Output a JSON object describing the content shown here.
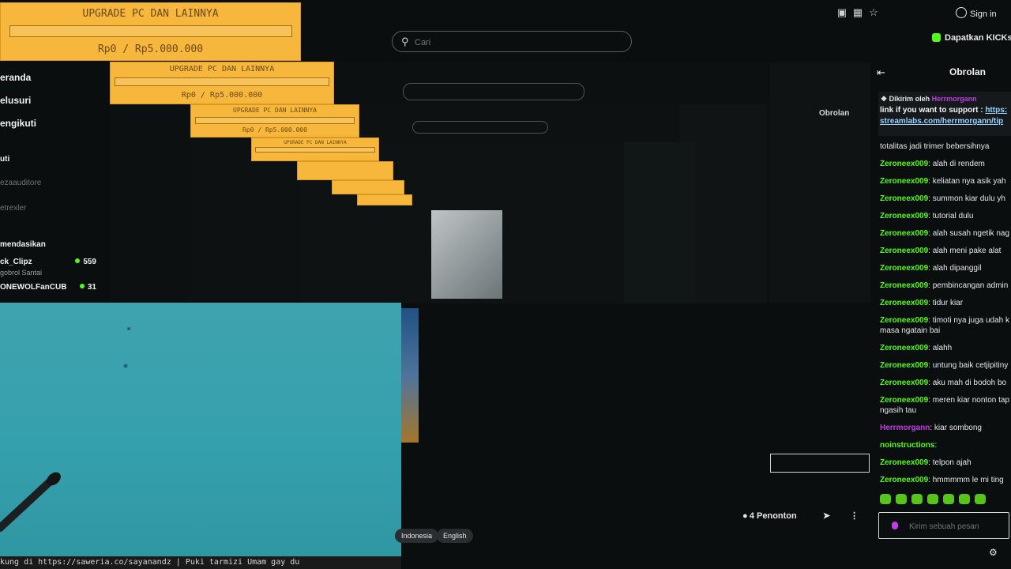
{
  "topbar": {
    "icons": [
      "pip-icon",
      "screen-icon",
      "star-icon"
    ],
    "sign_in": "Sign in"
  },
  "search": {
    "placeholder": "Cari",
    "icon": "search-icon"
  },
  "kicks_button": "Dapatkan KICKs",
  "donation": {
    "title": "UPGRADE PC DAN LAINNYA",
    "amount": "Rp0 / Rp5.000.000",
    "progress": 0,
    "color": "#f6b73c"
  },
  "sidebar": {
    "nav": [
      "eranda",
      "elusuri",
      "engikuti"
    ],
    "section_following": "uti",
    "followed": [
      "ezaauditore",
      "etrexler"
    ],
    "recommended_title": "mendasikan",
    "recommended": [
      {
        "name": "ck_Clipz",
        "sub": "gobrol Santai",
        "viewers": "559"
      },
      {
        "name": "ONEWOLFanCUB",
        "sub": "",
        "viewers": "31"
      }
    ]
  },
  "ticker": "kung di https://saweria.co/sayanandz |        Puki tarmizi Umam gay  du",
  "stream": {
    "languages": [
      "Indonesia",
      "English"
    ],
    "viewers": "4 Penonton"
  },
  "chat": {
    "title": "Obrolan",
    "pinned_by_label": "Dikirim oleh",
    "pinned_by": "Herrmorgann",
    "pinned_text": "link if you want to support :",
    "pinned_link_1": "https:",
    "pinned_link_2": "streamlabs.com/herrmorgann/tip",
    "messages": [
      {
        "user": "",
        "text": "totalitas jadi trimer bebersihnya"
      },
      {
        "user": "Zeroneex009",
        "text": "alah di rendem"
      },
      {
        "user": "Zeroneex009",
        "text": "keliatan nya asik yah"
      },
      {
        "user": "Zeroneex009",
        "text": "summon kiar dulu yh"
      },
      {
        "user": "Zeroneex009",
        "text": "tutorial dulu"
      },
      {
        "user": "Zeroneex009",
        "text": "alah susah ngetik nag"
      },
      {
        "user": "Zeroneex009",
        "text": "alah meni pake alat"
      },
      {
        "user": "Zeroneex009",
        "text": "alah dipanggil"
      },
      {
        "user": "Zeroneex009",
        "text": "pembincangan admin"
      },
      {
        "user": "Zeroneex009",
        "text": "tidur kiar"
      },
      {
        "user": "Zeroneex009",
        "text": "timoti nya juga udah k"
      },
      {
        "user": "",
        "text": "masa ngatain bai"
      },
      {
        "user": "Zeroneex009",
        "text": "alahh"
      },
      {
        "user": "Zeroneex009",
        "text": "untung baik cetjipitiny"
      },
      {
        "user": "Zeroneex009",
        "text": "aku mah di bodoh bo"
      },
      {
        "user": "Zeroneex009",
        "text": "meren kiar nonton tap"
      },
      {
        "user": "",
        "text": "ngasih tau"
      },
      {
        "user": "Herrmorgann",
        "text": "kiar sombong"
      },
      {
        "user": "noinstructions",
        "text": ""
      },
      {
        "user": "Zeroneex009",
        "text": "telpon ajah"
      },
      {
        "user": "Zeroneex009",
        "text": "hmmmmm le mi ting"
      }
    ],
    "input_placeholder": "Kirim sebuah pesan"
  }
}
